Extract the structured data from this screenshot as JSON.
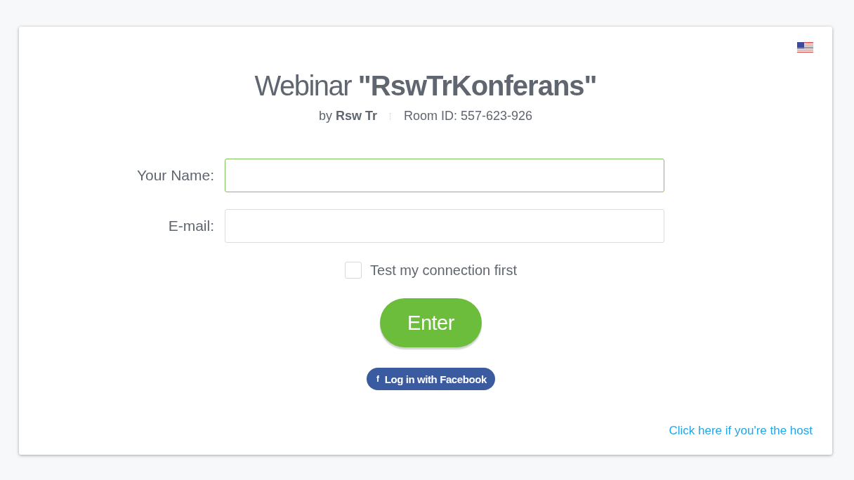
{
  "header": {
    "title": "Webinar **\"RswTrKonferans\"**",
    "organizer": "by **Rsw Tr**",
    "room_id": "Room ID: 557-623-926"
  },
  "fields": [
    {
      "label": "Your Name:",
      "focused": true
    },
    {
      "label": "E-mail:",
      "focused": false
    }
  ],
  "test_connection": {
    "label": "Test my connection first",
    "checked": false
  },
  "enter_button": "Enter",
  "facebook_button": {
    "icon": "f",
    "label": "Log in with Facebook"
  },
  "host_link": "Click here if you're the host"
}
